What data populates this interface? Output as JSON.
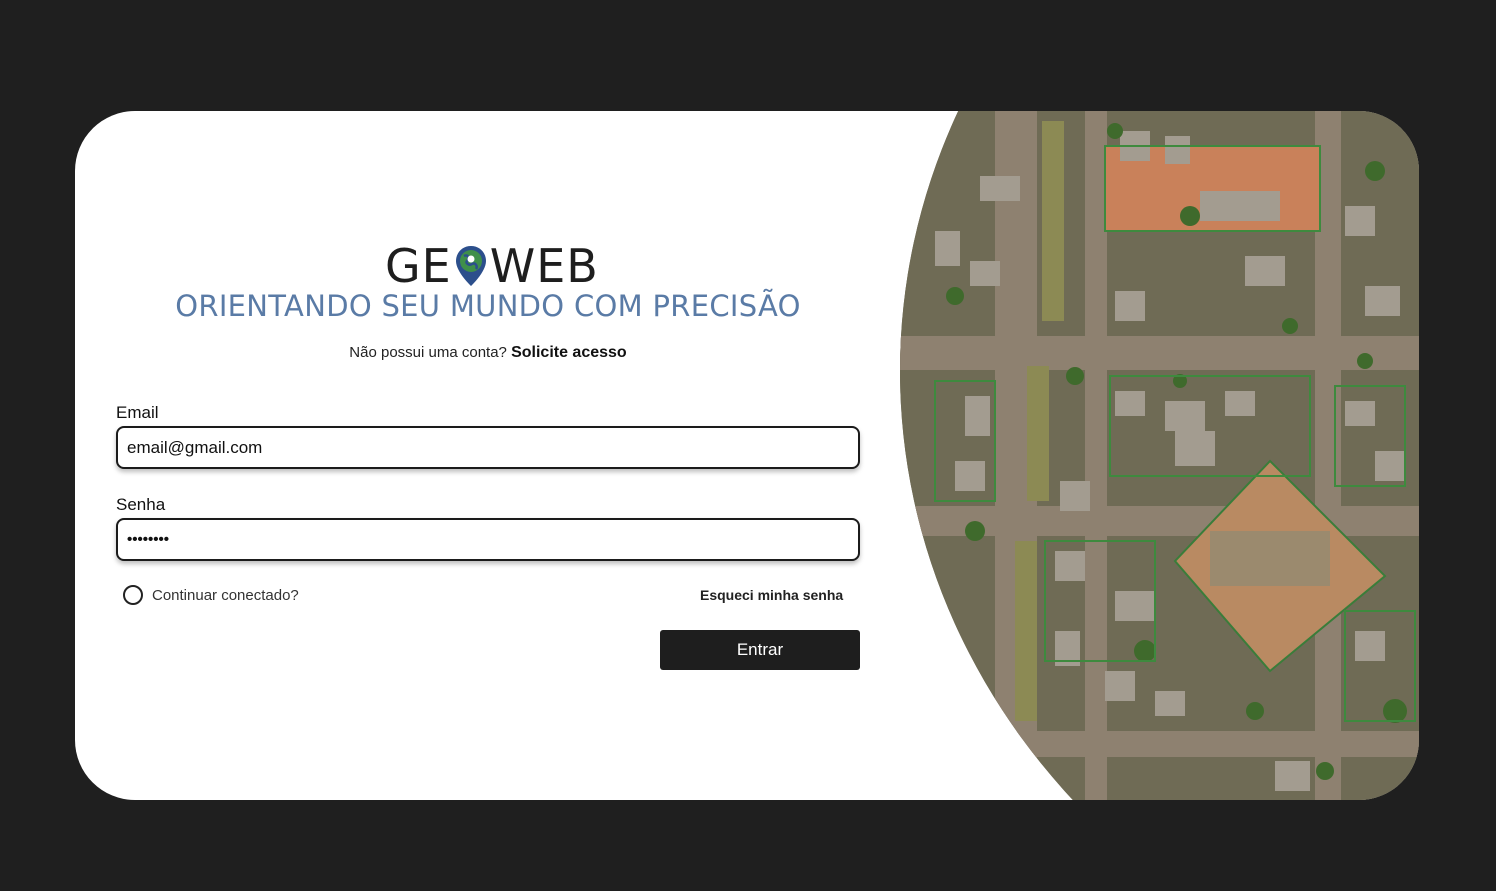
{
  "brand": {
    "part1": "GE",
    "part2": "WEB",
    "pin_icon": "map-pin-globe-icon"
  },
  "tagline": "ORIENTANDO SEU MUNDO COM PRECISÃO",
  "signup": {
    "prompt": "Não possui uma conta?",
    "link": "Solicite acesso"
  },
  "email": {
    "label": "Email",
    "value": "email@gmail.com"
  },
  "password": {
    "label": "Senha",
    "value": "••••••••"
  },
  "remember_label": "Continuar conectado?",
  "forgot_label": "Esqueci minha senha",
  "submit_label": "Entrar",
  "colors": {
    "background": "#1f1f1f",
    "tagline": "#5a7ba6",
    "button": "#1e1e1e"
  }
}
